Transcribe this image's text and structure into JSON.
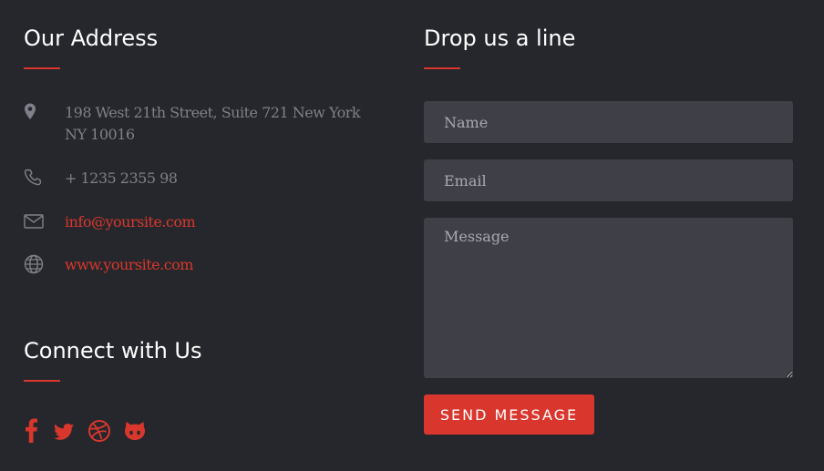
{
  "address_section": {
    "title": "Our Address",
    "items": [
      {
        "icon": "map-pin-icon",
        "text": "198 West 21th Street, Suite 721 New York NY 10016",
        "is_link": false
      },
      {
        "icon": "phone-icon",
        "text": "+ 1235 2355 98",
        "is_link": false
      },
      {
        "icon": "mail-icon",
        "text": "info@yoursite.com",
        "is_link": true
      },
      {
        "icon": "globe-icon",
        "text": "www.yoursite.com",
        "is_link": true
      }
    ]
  },
  "connect_section": {
    "title": "Connect with Us",
    "icons": [
      "facebook-icon",
      "twitter-icon",
      "dribbble-icon",
      "github-icon"
    ]
  },
  "contact_form": {
    "title": "Drop us a line",
    "name_placeholder": "Name",
    "email_placeholder": "Email",
    "message_placeholder": "Message",
    "submit_label": "SEND MESSAGE"
  },
  "colors": {
    "background": "#26272c",
    "accent": "#d9372d",
    "field_background": "#3f3f47",
    "muted_text": "#7f8089"
  }
}
